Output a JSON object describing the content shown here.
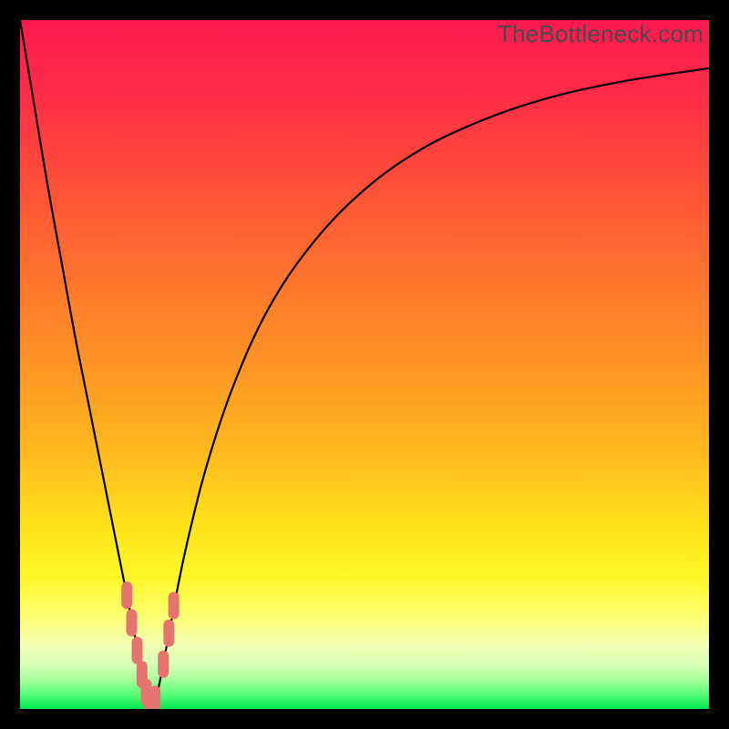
{
  "watermark": "TheBottleneck.com",
  "colors": {
    "marker": "#e5746f",
    "curve": "#000000",
    "frame": "#000000"
  },
  "gradient_stops": [
    {
      "offset": 0.0,
      "color": "#ff1950"
    },
    {
      "offset": 0.1,
      "color": "#ff2b48"
    },
    {
      "offset": 0.22,
      "color": "#ff4a3a"
    },
    {
      "offset": 0.35,
      "color": "#ff6e2f"
    },
    {
      "offset": 0.5,
      "color": "#ff9425"
    },
    {
      "offset": 0.63,
      "color": "#ffba1e"
    },
    {
      "offset": 0.74,
      "color": "#ffe41a"
    },
    {
      "offset": 0.81,
      "color": "#fff72a"
    },
    {
      "offset": 0.86,
      "color": "#fdff6a"
    },
    {
      "offset": 0.905,
      "color": "#f4ffb0"
    },
    {
      "offset": 0.935,
      "color": "#d8ffb8"
    },
    {
      "offset": 0.958,
      "color": "#a6ff9a"
    },
    {
      "offset": 0.978,
      "color": "#5bff78"
    },
    {
      "offset": 1.0,
      "color": "#00e84e"
    }
  ],
  "chart_data": {
    "type": "line",
    "title": "",
    "xlabel": "",
    "ylabel": "",
    "xlim": [
      0,
      100
    ],
    "ylim": [
      0,
      100
    ],
    "grid": false,
    "series": [
      {
        "name": "bottleneck-curve",
        "x": [
          0,
          2,
          4,
          6,
          8,
          10,
          12,
          14,
          15,
          16,
          17,
          18,
          18.7,
          19.5,
          20.5,
          22,
          24,
          27,
          31,
          36,
          42,
          49,
          57,
          66,
          76,
          87,
          100
        ],
        "y": [
          100,
          88,
          76,
          65,
          54,
          44,
          34,
          24,
          19,
          14,
          9,
          4,
          0.8,
          0.8,
          5,
          13,
          23,
          35,
          47,
          58,
          67,
          74.5,
          80.5,
          85,
          88.5,
          91,
          93
        ]
      }
    ],
    "markers": {
      "name": "scatter-points",
      "color": "#e5746f",
      "shape": "pill",
      "points": [
        {
          "x": 15.5,
          "y": 16.5
        },
        {
          "x": 16.2,
          "y": 12.5
        },
        {
          "x": 17.0,
          "y": 8.5
        },
        {
          "x": 17.7,
          "y": 5.0
        },
        {
          "x": 18.3,
          "y": 2.4
        },
        {
          "x": 18.8,
          "y": 0.9
        },
        {
          "x": 19.6,
          "y": 1.4
        },
        {
          "x": 20.8,
          "y": 6.5
        },
        {
          "x": 21.6,
          "y": 11.0
        },
        {
          "x": 22.3,
          "y": 15.0
        }
      ]
    }
  }
}
